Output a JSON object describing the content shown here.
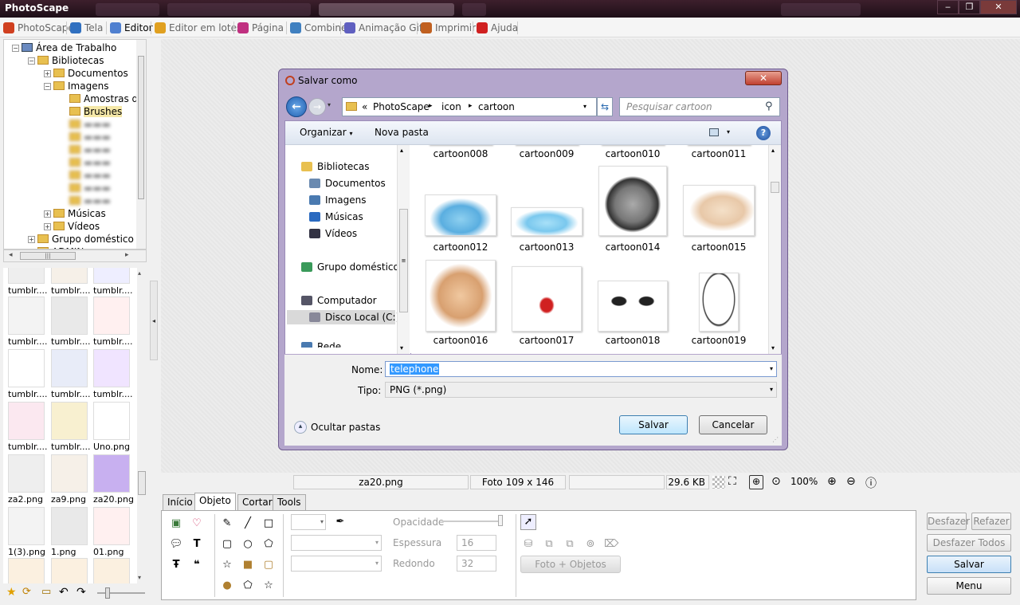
{
  "window": {
    "title": "PhotoScape",
    "controls": {
      "minimize": "‒",
      "maximize": "❐",
      "close": "✕"
    }
  },
  "menu": {
    "tabs": [
      {
        "label": "PhotoScape",
        "icon": "photoscape-icon",
        "color": "#d04020"
      },
      {
        "label": "Tela",
        "icon": "viewer-icon",
        "color": "#3070c0"
      },
      {
        "label": "Editor",
        "icon": "editor-icon",
        "color": "#5080d0"
      },
      {
        "label": "Editor em lotes",
        "icon": "batch-editor-icon",
        "color": "#e0a020"
      },
      {
        "label": "Página",
        "icon": "page-icon",
        "color": "#c03080"
      },
      {
        "label": "Combine",
        "icon": "combine-icon",
        "color": "#4080c0"
      },
      {
        "label": "Animação Gif",
        "icon": "gif-icon",
        "color": "#6060c0"
      },
      {
        "label": "Imprimir",
        "icon": "print-icon",
        "color": "#c06020"
      },
      {
        "label": "Ajuda",
        "icon": "help-icon",
        "color": "#d02020"
      }
    ],
    "active": "Editor"
  },
  "tree": {
    "items": [
      {
        "label": "Área de Trabalho",
        "level": 0,
        "expander": "⊟"
      },
      {
        "label": "Bibliotecas",
        "level": 1,
        "expander": "⊟"
      },
      {
        "label": "Documentos",
        "level": 2,
        "expander": "⊞"
      },
      {
        "label": "Imagens",
        "level": 2,
        "expander": "⊟"
      },
      {
        "label": "Amostras de",
        "level": 3,
        "expander": ""
      },
      {
        "label": "Brushes",
        "level": 3,
        "expander": ""
      },
      {
        "label": "Músicas",
        "level": 2,
        "expander": "⊞"
      },
      {
        "label": "Vídeos",
        "level": 2,
        "expander": "⊞"
      },
      {
        "label": "Grupo doméstico",
        "level": 1,
        "expander": "⊞"
      },
      {
        "label": "ADMIN",
        "level": 1,
        "expander": "⊞"
      }
    ]
  },
  "thumbnails": [
    {
      "name": "tumblr...."
    },
    {
      "name": "tumblr...."
    },
    {
      "name": "tumblr...."
    },
    {
      "name": "tumblr...."
    },
    {
      "name": "tumblr...."
    },
    {
      "name": "tumblr...."
    },
    {
      "name": "tumblr...."
    },
    {
      "name": "tumblr...."
    },
    {
      "name": "tumblr...."
    },
    {
      "name": "tumblr...."
    },
    {
      "name": "tumblr...."
    },
    {
      "name": "Uno.png"
    },
    {
      "name": "za2.png"
    },
    {
      "name": "za9.png"
    },
    {
      "name": "za20.png"
    },
    {
      "name": "1(3).png"
    },
    {
      "name": "1.png"
    },
    {
      "name": "01.png"
    }
  ],
  "status": {
    "filename": "za20.png",
    "photo_size": "Foto 109 x 146",
    "file_size": "29.6 KB",
    "zoom": "100%"
  },
  "editor_tabs": [
    "Início",
    "Objeto",
    "Cortar",
    "Tools"
  ],
  "editor_active_tab": "Objeto",
  "object_panel": {
    "opacity_label": "Opacidade",
    "thickness_label": "Espessura",
    "thickness_value": "16",
    "round_label": "Redondo",
    "round_value": "32",
    "photo_objects_button": "Foto + Objetos"
  },
  "right_buttons": {
    "undo": "Desfazer",
    "redo": "Refazer",
    "undo_all": "Desfazer Todos",
    "save": "Salvar",
    "menu": "Menu"
  },
  "dialog": {
    "title": "Salvar como",
    "breadcrumb": {
      "prefix": "«",
      "parts": [
        "PhotoScape",
        "icon",
        "cartoon"
      ]
    },
    "search_placeholder": "Pesquisar cartoon",
    "organize": "Organizar",
    "new_folder": "Nova pasta",
    "nav": [
      {
        "label": "Bibliotecas",
        "icon": "libraries-icon",
        "level": 0
      },
      {
        "label": "Documentos",
        "icon": "documents-icon",
        "level": 1
      },
      {
        "label": "Imagens",
        "icon": "images-icon",
        "level": 1
      },
      {
        "label": "Músicas",
        "icon": "music-icon",
        "level": 1
      },
      {
        "label": "Vídeos",
        "icon": "videos-icon",
        "level": 1
      },
      {
        "label": "Grupo doméstico",
        "icon": "homegroup-icon",
        "level": 0
      },
      {
        "label": "Computador",
        "icon": "computer-icon",
        "level": 0
      },
      {
        "label": "Disco Local (C:)",
        "icon": "drive-icon",
        "level": 1
      },
      {
        "label": "Rede",
        "icon": "network-icon",
        "level": 0
      }
    ],
    "files_top_row": [
      "cartoon008",
      "cartoon009",
      "cartoon010",
      "cartoon011"
    ],
    "files": [
      {
        "name": "cartoon012"
      },
      {
        "name": "cartoon013"
      },
      {
        "name": "cartoon014"
      },
      {
        "name": "cartoon015"
      },
      {
        "name": "cartoon016"
      },
      {
        "name": "cartoon017"
      },
      {
        "name": "cartoon018"
      },
      {
        "name": "cartoon019"
      }
    ],
    "name_label": "Nome:",
    "name_value": "telephone",
    "type_label": "Tipo:",
    "type_value": "PNG (*.png)",
    "hide_folders": "Ocultar pastas",
    "save_button": "Salvar",
    "cancel_button": "Cancelar"
  }
}
